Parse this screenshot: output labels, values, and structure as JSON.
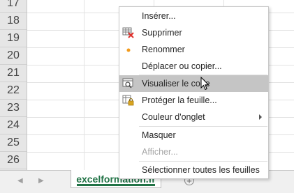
{
  "rows": [
    "17",
    "18",
    "19",
    "20",
    "21",
    "22",
    "23",
    "24",
    "25",
    "26"
  ],
  "sheet_tab": {
    "label": "excelformation.fr"
  },
  "context_menu": {
    "items": [
      {
        "label": "Insérer...",
        "icon": "",
        "disabled": false
      },
      {
        "label": "Supprimer",
        "icon": "delete-sheet-icon",
        "disabled": false
      },
      {
        "label": "Renommer",
        "icon": "bullet-dot-icon",
        "disabled": false
      },
      {
        "label": "Déplacer ou copier...",
        "icon": "",
        "disabled": false
      },
      {
        "label": "Visualiser le code",
        "icon": "view-code-icon",
        "disabled": false,
        "highlighted": true
      },
      {
        "label": "Protéger la feuille...",
        "icon": "protect-sheet-icon",
        "disabled": false
      },
      {
        "label": "Couleur d'onglet",
        "icon": "",
        "disabled": false,
        "submenu": true
      },
      {
        "label": "Masquer",
        "icon": "",
        "disabled": false
      },
      {
        "label": "Afficher...",
        "icon": "",
        "disabled": true
      },
      {
        "label": "Sélectionner toutes les feuilles",
        "icon": "",
        "disabled": false
      }
    ]
  },
  "colors": {
    "accent": "#217346",
    "highlight": "#c5c5c5",
    "delete_red": "#e0302b",
    "bullet_orange": "#f29b1d",
    "lock_gold": "#d9a520"
  }
}
